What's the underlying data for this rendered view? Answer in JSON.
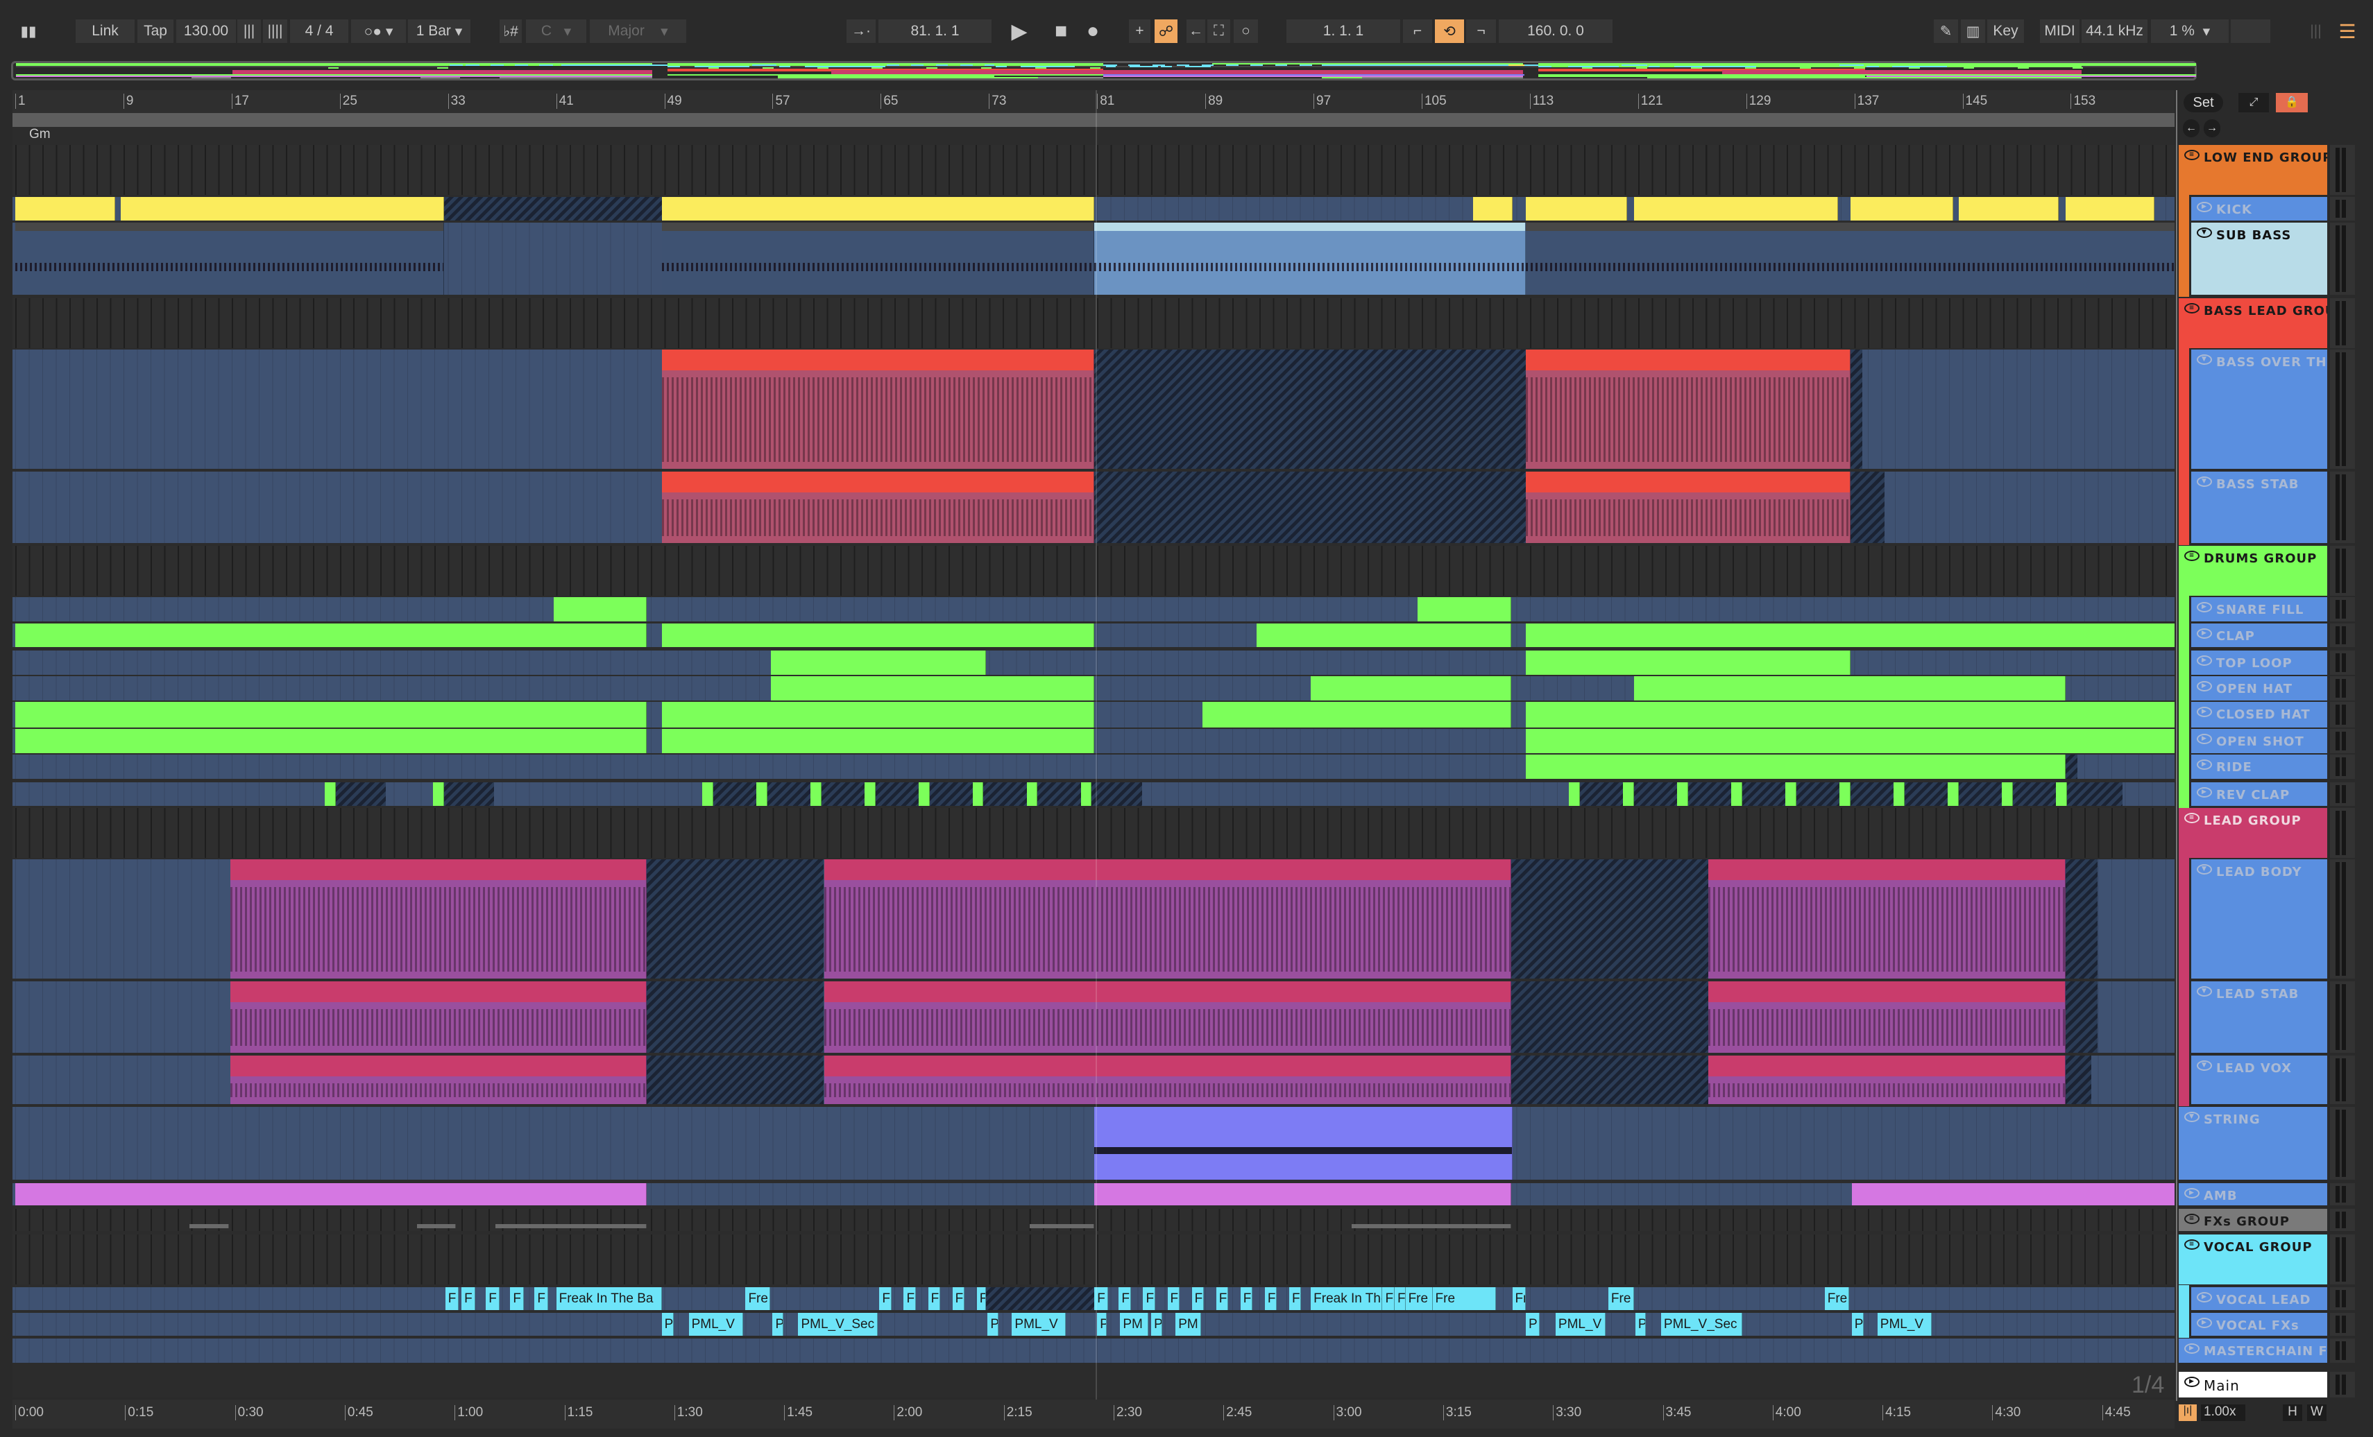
{
  "toolbar": {
    "link": "Link",
    "tap": "Tap",
    "tempo": "130.00",
    "time_signature": "4 / 4",
    "quantize": "1 Bar",
    "key_toggle": "♭#",
    "key_root": "C",
    "key_scale": "Major",
    "position": "81.  1.  1",
    "loop_start": "1.  1.  1",
    "loop_length": "160.  0.  0",
    "key_map": "Key",
    "midi_map": "MIDI",
    "sample_rate": "44.1 kHz",
    "cpu": "1 %"
  },
  "ruler": {
    "bars": [
      "1",
      "9",
      "17",
      "25",
      "33",
      "41",
      "49",
      "57",
      "65",
      "73",
      "81",
      "89",
      "97",
      "105",
      "113",
      "121",
      "129",
      "137",
      "145",
      "153"
    ],
    "times": [
      "0:00",
      "0:15",
      "0:30",
      "0:45",
      "1:00",
      "1:15",
      "1:30",
      "1:45",
      "2:00",
      "2:15",
      "2:30",
      "2:45",
      "3:00",
      "3:15",
      "3:30",
      "3:45",
      "4:00",
      "4:15",
      "4:30",
      "4:45"
    ],
    "scale_label": "Gm",
    "grid_label": "1/4"
  },
  "right_panel": {
    "set": "Set",
    "zoom": "1.00x",
    "h": "H",
    "w": "W"
  },
  "colors": {
    "kick": "#fbec5d",
    "bass": "#ef4a3f",
    "drums": "#7cff5a",
    "lead": "#c93c6c",
    "lead_body": "#9a4f9e",
    "string": "#7d7cf4",
    "amb": "#d577e2",
    "vocal": "#6de4f8",
    "track_header": "#5a8fe0",
    "low_end": "#e6782e",
    "fx": "#7a7a7a"
  },
  "tracks": [
    {
      "name": "LOW END GROUP",
      "kind": "group",
      "color": "#e6782e",
      "clips": []
    },
    {
      "name": "KICK",
      "kind": "child",
      "color": "#fbec5d",
      "clips": [
        [
          1,
          8.4,
          "c"
        ],
        [
          8.8,
          32.7,
          "c"
        ],
        [
          32.7,
          48.8,
          "h"
        ],
        [
          48.8,
          80.8,
          "c"
        ],
        [
          108.8,
          111.7,
          "c"
        ],
        [
          112.7,
          120.2,
          "c"
        ],
        [
          120.7,
          135.8,
          "c"
        ],
        [
          136.7,
          144.3,
          "c"
        ],
        [
          144.7,
          152.1,
          "c"
        ],
        [
          152.6,
          159.2,
          "c"
        ]
      ]
    },
    {
      "name": "SUB BASS",
      "kind": "child",
      "selected": true,
      "color": "#474747",
      "body": "#3e5272",
      "clips": [
        [
          1,
          32.7,
          "c"
        ],
        [
          48.8,
          80.8,
          "c"
        ],
        [
          80.8,
          112.7,
          "s"
        ],
        [
          112.7,
          161,
          "c"
        ]
      ]
    },
    {
      "name": "BASS LEAD GROU",
      "kind": "group",
      "color": "#ef4a3f",
      "clips": []
    },
    {
      "name": "BASS OVER THE",
      "kind": "child",
      "color": "#ef4a3f",
      "body": "#b0526e",
      "clips": [
        [
          48.8,
          80.8,
          "c"
        ],
        [
          80.8,
          112.7,
          "h"
        ],
        [
          112.7,
          136.7,
          "c"
        ],
        [
          136.7,
          137.6,
          "h"
        ]
      ]
    },
    {
      "name": "BASS STAB",
      "kind": "child",
      "color": "#ef4a3f",
      "body": "#b0526e",
      "clips": [
        [
          48.8,
          80.8,
          "c"
        ],
        [
          80.8,
          112.7,
          "h"
        ],
        [
          112.7,
          136.7,
          "c"
        ],
        [
          136.7,
          139.2,
          "h"
        ]
      ]
    },
    {
      "name": "DRUMS GROUP",
      "kind": "group",
      "color": "#7cff5a",
      "clips": []
    },
    {
      "name": "SNARE FILL",
      "kind": "child",
      "color": "#7cff5a",
      "clips": [
        [
          40.8,
          47.7,
          "c"
        ],
        [
          104.7,
          111.6,
          "c"
        ]
      ]
    },
    {
      "name": "CLAP",
      "kind": "child",
      "color": "#7cff5a",
      "clips": [
        [
          1,
          47.7,
          "c"
        ],
        [
          48.8,
          80.8,
          "c"
        ],
        [
          92.8,
          111.6,
          "c"
        ],
        [
          112.7,
          161,
          "c"
        ]
      ]
    },
    {
      "name": "TOP LOOP",
      "kind": "child",
      "color": "#7cff5a",
      "clips": [
        [
          56.9,
          72.8,
          "c"
        ],
        [
          112.7,
          136.7,
          "c"
        ]
      ]
    },
    {
      "name": "OPEN HAT",
      "kind": "child",
      "color": "#7cff5a",
      "clips": [
        [
          56.9,
          80.8,
          "c"
        ],
        [
          96.8,
          111.6,
          "c"
        ],
        [
          120.7,
          152.6,
          "c"
        ]
      ]
    },
    {
      "name": "CLOSED HAT",
      "kind": "child",
      "color": "#7cff5a",
      "clips": [
        [
          1,
          47.7,
          "c"
        ],
        [
          48.8,
          80.8,
          "c"
        ],
        [
          88.8,
          111.6,
          "c"
        ],
        [
          112.7,
          161,
          "c"
        ]
      ]
    },
    {
      "name": "OPEN SHOT",
      "kind": "child",
      "color": "#7cff5a",
      "clips": [
        [
          1,
          47.7,
          "c"
        ],
        [
          48.8,
          80.8,
          "c"
        ],
        [
          112.7,
          161,
          "c"
        ]
      ]
    },
    {
      "name": "RIDE",
      "kind": "child",
      "color": "#7cff5a",
      "clips": [
        [
          112.7,
          152.6,
          "c"
        ],
        [
          152.6,
          153.5,
          "h"
        ]
      ]
    },
    {
      "name": "REV CLAP",
      "kind": "child",
      "color": "#7cff5a",
      "clips": [
        [
          24.7,
          28.4,
          "h"
        ],
        [
          32.7,
          36.4,
          "h"
        ],
        [
          52.6,
          84.3,
          "h"
        ],
        [
          116.7,
          156.8,
          "h"
        ],
        [
          23.9,
          24.7,
          "c"
        ],
        [
          31.9,
          32.7,
          "c"
        ],
        [
          51.8,
          52.6,
          "c"
        ],
        [
          55.8,
          56.6,
          "c"
        ],
        [
          59.8,
          60.6,
          "c"
        ],
        [
          63.8,
          64.6,
          "c"
        ],
        [
          67.8,
          68.6,
          "c"
        ],
        [
          71.8,
          72.6,
          "c"
        ],
        [
          75.8,
          76.6,
          "c"
        ],
        [
          79.8,
          80.6,
          "c"
        ],
        [
          115.9,
          116.7,
          "c"
        ],
        [
          119.9,
          120.7,
          "c"
        ],
        [
          123.9,
          124.7,
          "c"
        ],
        [
          127.9,
          128.7,
          "c"
        ],
        [
          131.9,
          132.7,
          "c"
        ],
        [
          135.9,
          136.7,
          "c"
        ],
        [
          139.9,
          140.7,
          "c"
        ],
        [
          143.9,
          144.7,
          "c"
        ],
        [
          147.9,
          148.7,
          "c"
        ],
        [
          151.9,
          152.7,
          "c"
        ]
      ]
    },
    {
      "name": "LEAD GROUP",
      "kind": "group",
      "color": "#c93c6c",
      "clips": []
    },
    {
      "name": "LEAD BODY",
      "kind": "child",
      "color": "#c93c6c",
      "body": "#9a4f9e",
      "clips": [
        [
          16.9,
          47.7,
          "c"
        ],
        [
          47.7,
          60.8,
          "h"
        ],
        [
          60.8,
          111.6,
          "c"
        ],
        [
          111.6,
          126.2,
          "h"
        ],
        [
          126.2,
          152.6,
          "c"
        ],
        [
          152.6,
          155,
          "h"
        ]
      ]
    },
    {
      "name": "LEAD STAB",
      "kind": "child",
      "color": "#c93c6c",
      "body": "#9a4f9e",
      "clips": [
        [
          16.9,
          47.7,
          "c"
        ],
        [
          47.7,
          60.8,
          "h"
        ],
        [
          60.8,
          111.6,
          "c"
        ],
        [
          111.6,
          126.2,
          "h"
        ],
        [
          126.2,
          152.6,
          "c"
        ],
        [
          152.6,
          155,
          "h"
        ]
      ]
    },
    {
      "name": "LEAD VOX",
      "kind": "child",
      "color": "#c93c6c",
      "body": "#9a4f9e",
      "clips": [
        [
          16.9,
          47.7,
          "c"
        ],
        [
          47.7,
          60.8,
          "h"
        ],
        [
          60.8,
          111.6,
          "c"
        ],
        [
          111.6,
          126.2,
          "h"
        ],
        [
          126.2,
          152.6,
          "c"
        ],
        [
          152.6,
          154.5,
          "h"
        ]
      ]
    },
    {
      "name": "STRING",
      "kind": "top",
      "color": "#7d7cf4",
      "clips": [
        [
          80.8,
          111.7,
          "c"
        ]
      ]
    },
    {
      "name": "AMB",
      "kind": "top",
      "color": "#d577e2",
      "clips": [
        [
          1,
          47.7,
          "c"
        ],
        [
          80.8,
          111.6,
          "c"
        ],
        [
          136.8,
          161,
          "c"
        ]
      ]
    },
    {
      "name": "FXs GROUP",
      "kind": "group",
      "color": "#7a7a7a",
      "clips": [
        [
          13.9,
          16.8,
          "g"
        ],
        [
          30.7,
          33.6,
          "g"
        ],
        [
          36.5,
          47.7,
          "g"
        ],
        [
          76,
          80.8,
          "g"
        ],
        [
          99.8,
          111.6,
          "g"
        ]
      ]
    },
    {
      "name": "VOCAL GROUP",
      "kind": "group",
      "color": "#6de4f8",
      "clips": []
    },
    {
      "name": "VOCAL LEAD",
      "kind": "child",
      "color": "#6de4f8",
      "clips": [
        [
          32.8,
          33.8,
          "c",
          "F"
        ],
        [
          34,
          35,
          "c",
          "F"
        ],
        [
          35.8,
          36.8,
          "c",
          "F"
        ],
        [
          37.6,
          38.6,
          "c",
          "F"
        ],
        [
          39.4,
          40.4,
          "c",
          "F"
        ],
        [
          41,
          48.8,
          "c",
          "Freak In The Ba"
        ],
        [
          55,
          56.8,
          "c",
          "Fre"
        ],
        [
          64.9,
          65.8,
          "c",
          "F"
        ],
        [
          66.7,
          67.6,
          "c",
          "F"
        ],
        [
          68.5,
          69.4,
          "c",
          "F"
        ],
        [
          70.3,
          71.2,
          "c",
          "F"
        ],
        [
          72.1,
          72.8,
          "c",
          "F"
        ],
        [
          72.8,
          80.8,
          "h"
        ],
        [
          80.8,
          81.8,
          "c",
          "F"
        ],
        [
          82.6,
          83.5,
          "c",
          "F"
        ],
        [
          84.4,
          85.3,
          "c",
          "F"
        ],
        [
          86.2,
          87.1,
          "c",
          "F"
        ],
        [
          88,
          88.9,
          "c",
          "F"
        ],
        [
          89.8,
          90.7,
          "c",
          "F"
        ],
        [
          91.6,
          92.5,
          "c",
          "F"
        ],
        [
          93.4,
          94.3,
          "c",
          "F"
        ],
        [
          95.2,
          96.1,
          "c",
          "F"
        ],
        [
          96.8,
          102.1,
          "c",
          "Freak In The"
        ],
        [
          102.1,
          103,
          "c",
          "F"
        ],
        [
          103,
          103.8,
          "c",
          "Fr"
        ],
        [
          103.8,
          105.8,
          "c",
          "Fre"
        ],
        [
          105.8,
          110.5,
          "c",
          "Fre"
        ],
        [
          111.7,
          112.7,
          "c",
          "Fr"
        ],
        [
          118.8,
          120.7,
          "c",
          "Fre"
        ],
        [
          134.8,
          136.6,
          "c",
          "Fre"
        ]
      ]
    },
    {
      "name": "VOCAL FXs",
      "kind": "child",
      "color": "#6de4f8",
      "clips": [
        [
          48.8,
          49.7,
          "c",
          "P"
        ],
        [
          50.8,
          54.8,
          "c",
          "PML_V"
        ],
        [
          57,
          57.8,
          "c",
          "P"
        ],
        [
          58.9,
          64.8,
          "c",
          "PML_V_Sec"
        ],
        [
          72.9,
          73.7,
          "c",
          "P"
        ],
        [
          74.7,
          78.7,
          "c",
          "PML_V"
        ],
        [
          81,
          81.7,
          "c",
          "P"
        ],
        [
          82.7,
          84.8,
          "c",
          "PM"
        ],
        [
          85,
          85.8,
          "c",
          "P"
        ],
        [
          86.8,
          88.7,
          "c",
          "PM"
        ],
        [
          112.7,
          113.7,
          "c",
          "P"
        ],
        [
          114.9,
          118.6,
          "c",
          "PML_V"
        ],
        [
          120.8,
          121.6,
          "c",
          "P"
        ],
        [
          122.7,
          128.7,
          "c",
          "PML_V_Sec"
        ],
        [
          136.8,
          137.7,
          "c",
          "P"
        ],
        [
          138.7,
          142.7,
          "c",
          "PML_V"
        ]
      ]
    },
    {
      "name": "MASTERCHAIN F",
      "kind": "top",
      "color": "#5a8fe0",
      "clips": []
    },
    {
      "name": "Main",
      "kind": "main",
      "color": "#ffffff",
      "clips": []
    }
  ]
}
